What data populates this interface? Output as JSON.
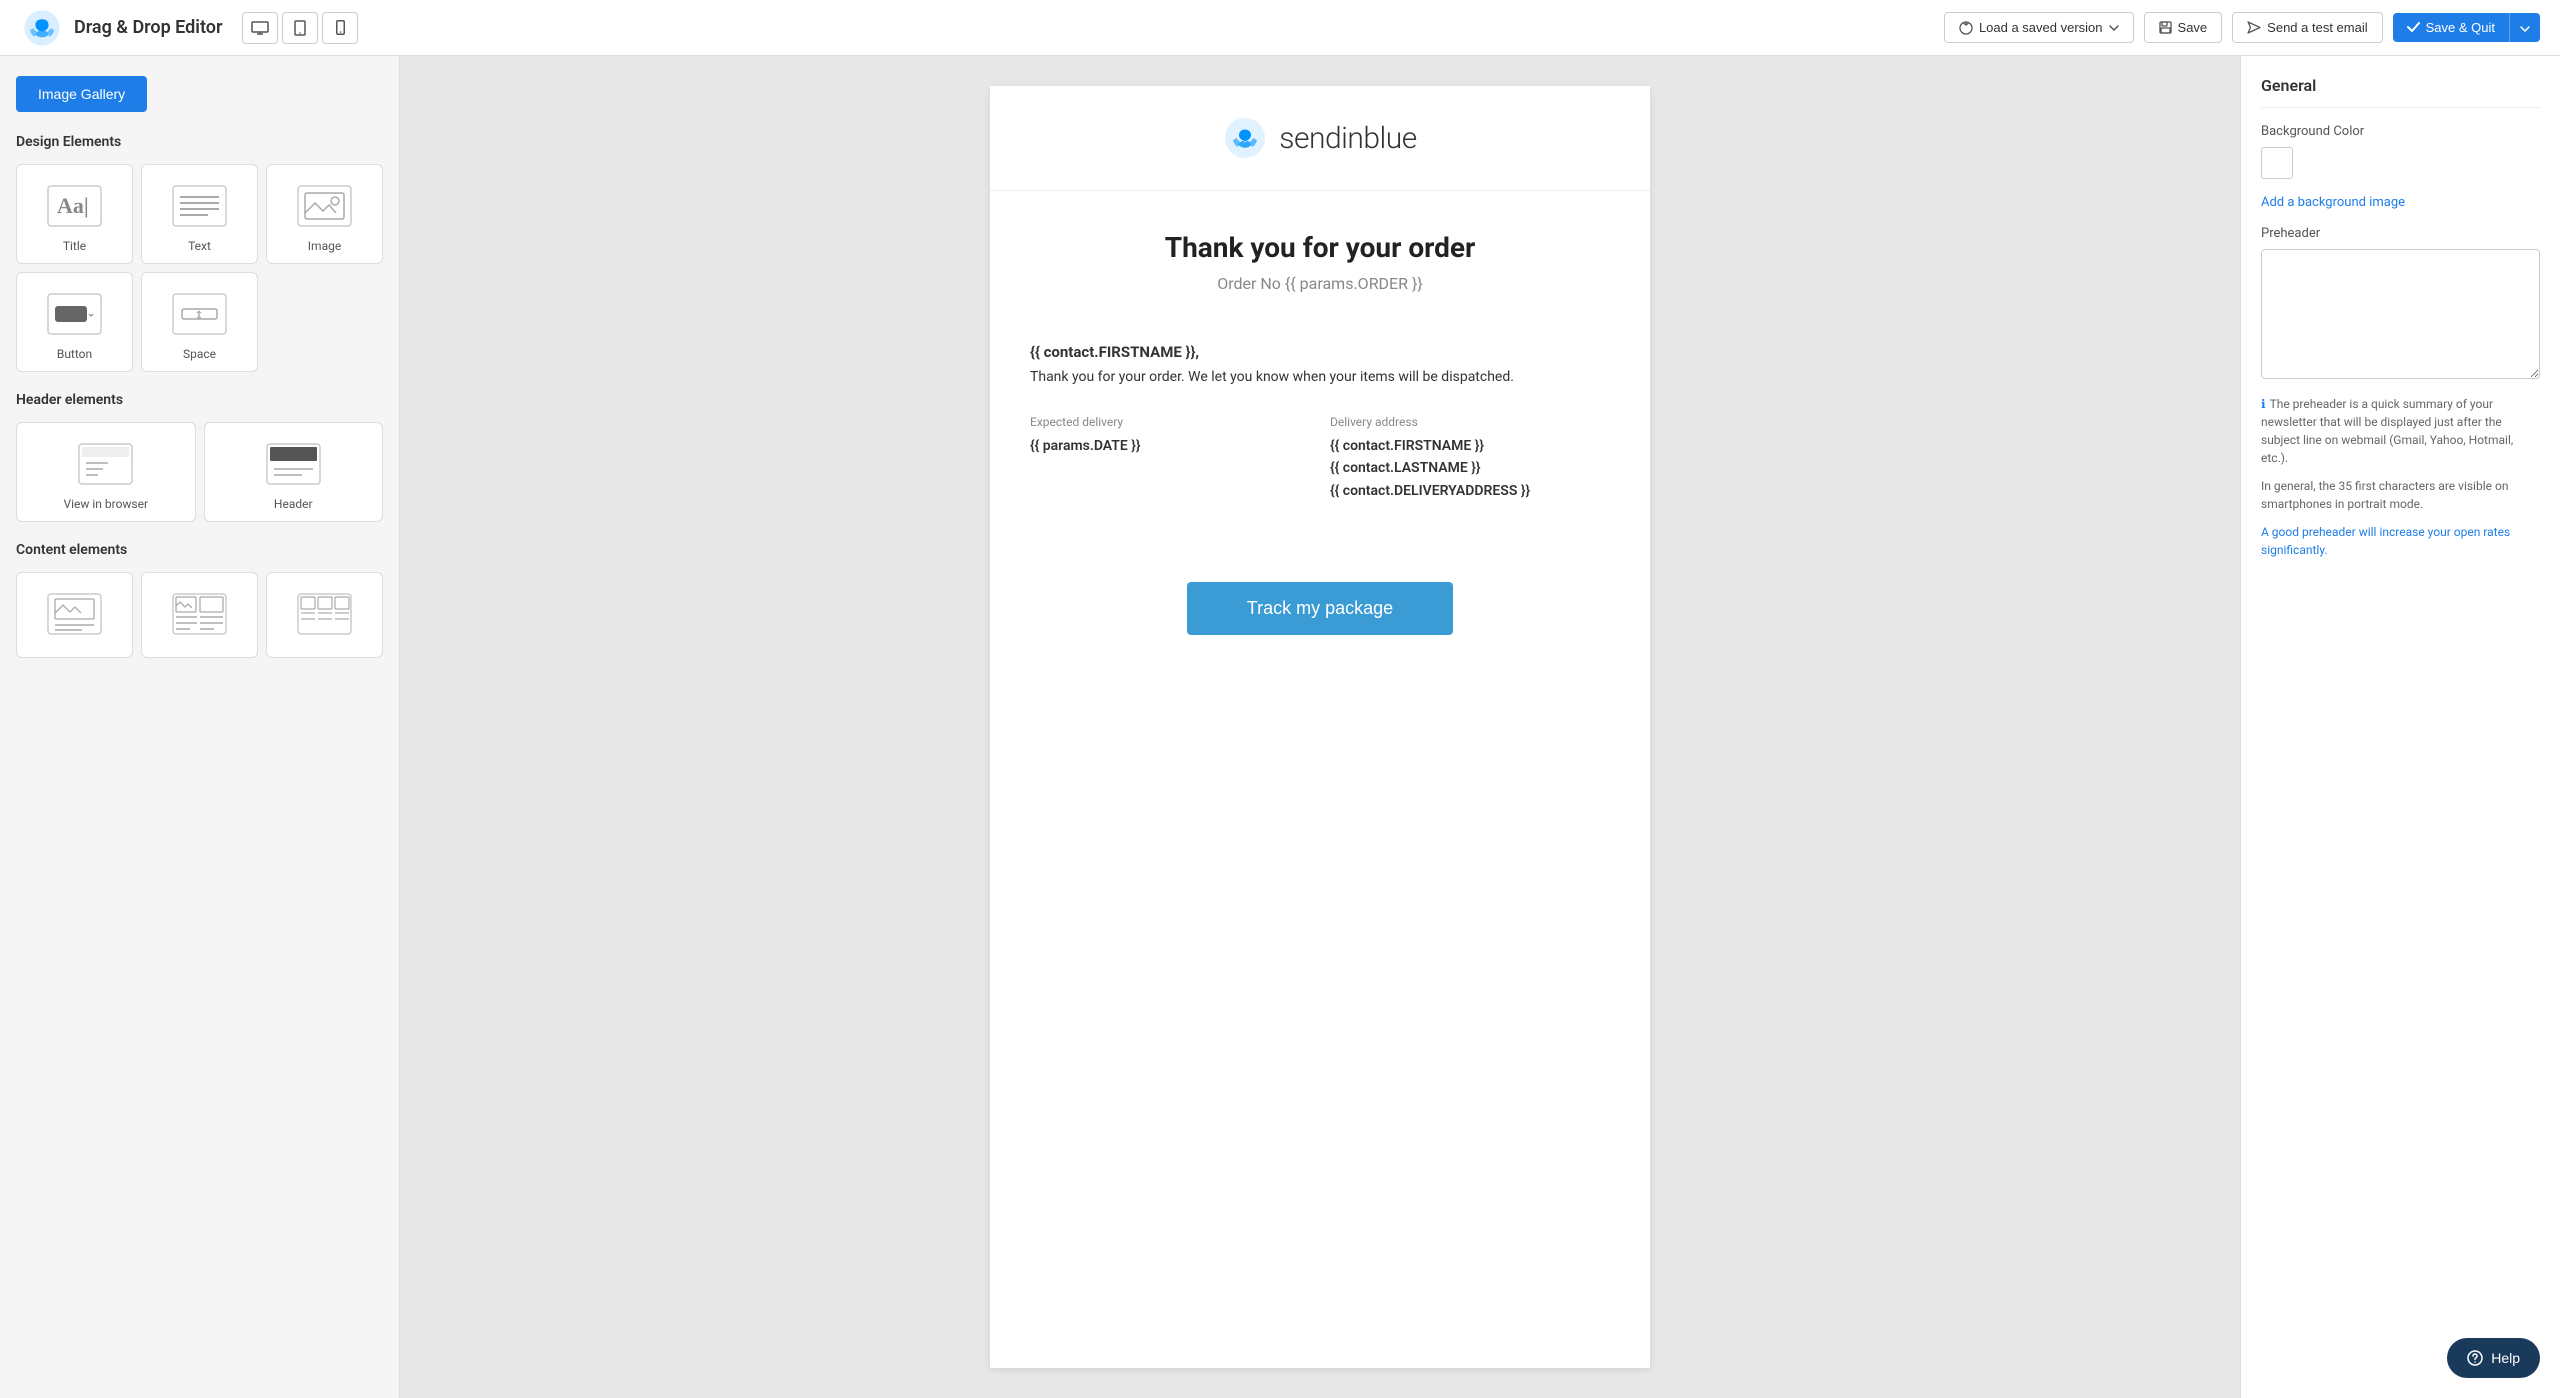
{
  "app": {
    "title": "Drag & Drop Editor"
  },
  "header": {
    "load_version_label": "Load a saved version",
    "save_label": "Save",
    "send_test_label": "Send a test email",
    "save_quit_label": "Save & Quit"
  },
  "sidebar": {
    "image_gallery_label": "Image Gallery",
    "design_elements_title": "Design Elements",
    "design_elements": [
      {
        "id": "title",
        "label": "Title"
      },
      {
        "id": "text",
        "label": "Text"
      },
      {
        "id": "image",
        "label": "Image"
      },
      {
        "id": "button",
        "label": "Button"
      },
      {
        "id": "space",
        "label": "Space"
      }
    ],
    "header_elements_title": "Header elements",
    "header_elements": [
      {
        "id": "view-in-browser",
        "label": "View in browser"
      },
      {
        "id": "header",
        "label": "Header"
      }
    ],
    "content_elements_title": "Content elements"
  },
  "email": {
    "brand_name": "sendinblue",
    "hero_title": "Thank you for your order",
    "order_line": "Order No {{ params.ORDER }}",
    "greeting_name": "{{ contact.FIRSTNAME }},",
    "greeting_body": "Thank you for your order. We let you know when your items will be dispatched.",
    "expected_delivery_label": "Expected delivery",
    "expected_delivery_value": "{{ params.DATE }}",
    "delivery_address_label": "Delivery address",
    "delivery_address_line1": "{{ contact.FIRSTNAME }}",
    "delivery_address_line2": "{{ contact.LASTNAME }}",
    "delivery_address_line3": "{{ contact.DELIVERYADDRESS }}",
    "track_button_label": "Track my package"
  },
  "right_panel": {
    "title": "General",
    "bg_color_label": "Background Color",
    "add_bg_image_label": "Add a background image",
    "preheader_label": "Preheader",
    "preheader_placeholder": "",
    "info_text_1": "The preheader is a quick summary of your newsletter that will be displayed just after the subject line on webmail (Gmail, Yahoo, Hotmail, etc.).",
    "info_text_2": "In general, the 35 first characters are visible on smartphones in portrait mode.",
    "info_text_highlight": "A good preheader will increase your open rates significantly."
  },
  "help": {
    "label": "Help"
  }
}
